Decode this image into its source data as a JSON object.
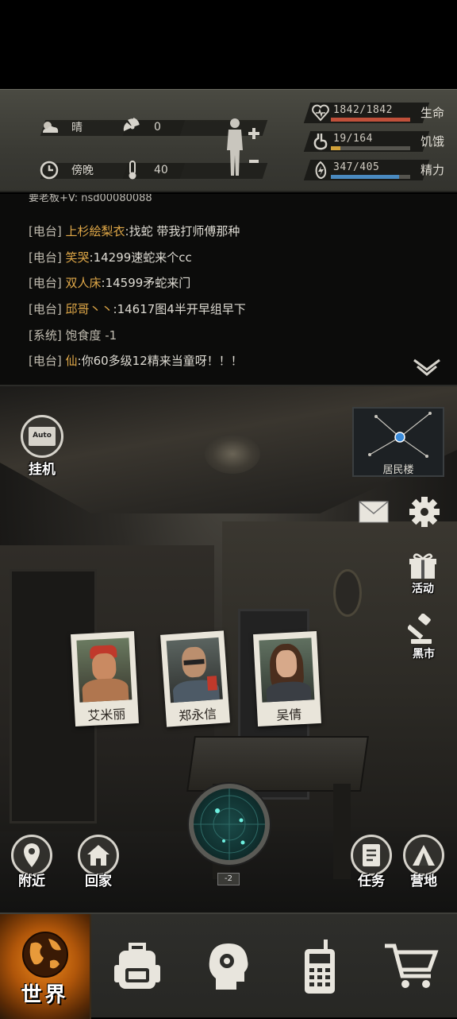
{
  "status": {
    "weather": "晴",
    "radiation": "0",
    "time_of_day": "傍晚",
    "temperature": "40",
    "stats": [
      {
        "label": "生命",
        "value": "1842/1842",
        "fill": 1.0,
        "color": "#c0503a",
        "icon": "heart-icon"
      },
      {
        "label": "饥饿",
        "value": "19/164",
        "fill": 0.116,
        "color": "#d2a23a",
        "icon": "stomach-icon"
      },
      {
        "label": "精力",
        "value": "347/405",
        "fill": 0.857,
        "color": "#4a8ac0",
        "icon": "energy-icon"
      }
    ]
  },
  "chat": {
    "partial_line": "要老板+V: nsd00080088",
    "lines": [
      {
        "channel": "[电台]",
        "who": "上杉絵梨衣",
        "msg": ":找蛇 带我打师傅那种"
      },
      {
        "channel": "[电台]",
        "who": "笑哭",
        "msg": ":14299速蛇来个cc"
      },
      {
        "channel": "[电台]",
        "who": "双人床",
        "msg": ":14599矛蛇来门"
      },
      {
        "channel": "[电台]",
        "who": "邱哥丶丶",
        "msg": ":14617图4半开早组早下"
      },
      {
        "channel": "[系统]",
        "who": "",
        "msg": "饱食度 -1"
      },
      {
        "channel": "[电台]",
        "who": "仙",
        "msg": ":你60多级12精来当童呀！！！"
      }
    ]
  },
  "scene": {
    "auto_label": "挂机",
    "auto_badge": "Auto",
    "location": "居民楼",
    "activity_label": "活动",
    "market_label": "黑市",
    "nearby_label": "附近",
    "home_label": "回家",
    "task_label": "任务",
    "camp_label": "营地",
    "radar_level": "-2",
    "characters": [
      {
        "name": "艾米丽"
      },
      {
        "name": "郑永信"
      },
      {
        "name": "吴倩"
      }
    ]
  },
  "nav": {
    "world": "世界"
  }
}
